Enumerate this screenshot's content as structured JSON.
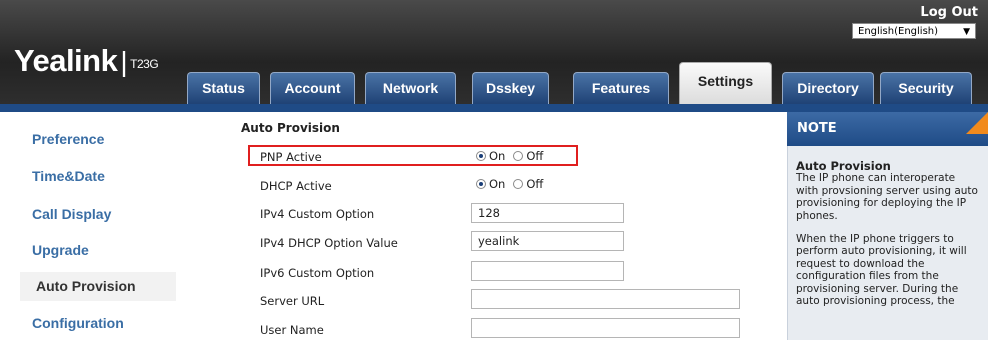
{
  "header": {
    "logout": "Log Out",
    "language": "English(English)",
    "logo_brand": "Yealink",
    "logo_model": "T23G"
  },
  "tabs": [
    {
      "label": "Status"
    },
    {
      "label": "Account"
    },
    {
      "label": "Network"
    },
    {
      "label": "Dsskey"
    },
    {
      "label": "Features"
    },
    {
      "label": "Settings",
      "active": true
    },
    {
      "label": "Directory"
    },
    {
      "label": "Security"
    }
  ],
  "sidebar": {
    "items": [
      {
        "label": "Preference"
      },
      {
        "label": "Time&Date"
      },
      {
        "label": "Call Display"
      },
      {
        "label": "Upgrade"
      },
      {
        "label": "Auto Provision",
        "active": true
      },
      {
        "label": "Configuration"
      }
    ]
  },
  "form": {
    "section_title": "Auto Provision",
    "pnp_active": {
      "label": "PNP Active",
      "on": "On",
      "off": "Off",
      "selected": "On"
    },
    "dhcp_active": {
      "label": "DHCP Active",
      "on": "On",
      "off": "Off",
      "selected": "On"
    },
    "ipv4_custom_option": {
      "label": "IPv4 Custom Option",
      "value": "128"
    },
    "ipv4_dhcp_option_value": {
      "label": "IPv4 DHCP Option Value",
      "value": "yealink"
    },
    "ipv6_custom_option": {
      "label": "IPv6 Custom Option",
      "value": ""
    },
    "server_url": {
      "label": "Server URL",
      "value": ""
    },
    "user_name": {
      "label": "User Name",
      "value": ""
    }
  },
  "note": {
    "header": "NOTE",
    "title": "Auto Provision",
    "para1": "The IP phone can interoperate with provsioning server using auto provisioning for deploying the IP phones.",
    "para2": "When the IP phone triggers to perform auto provisioning, it will request to download the configuration files from the provisioning server. During the auto provisioning process, the"
  },
  "colors": {
    "header_dark": "#232323",
    "tab_blue": "#1f4275",
    "stripe_blue": "#1f4b86",
    "sidebar_link": "#3a6ea5",
    "highlight_red": "#e01f1f",
    "note_corner": "#f18a1c"
  }
}
